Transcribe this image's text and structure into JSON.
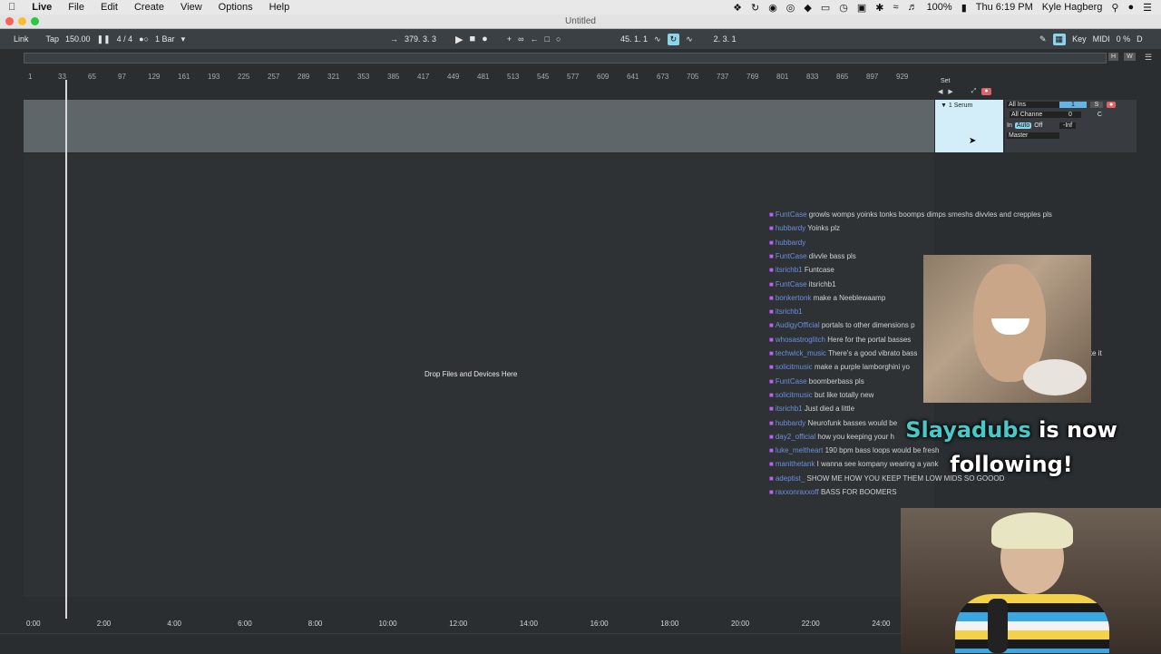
{
  "menubar": {
    "apple": "",
    "app": "Live",
    "items": [
      "File",
      "Edit",
      "Create",
      "View",
      "Options",
      "Help"
    ],
    "battery": "100%",
    "time": "Thu 6:19 PM",
    "user": "Kyle Hagberg"
  },
  "window": {
    "title": "Untitled"
  },
  "control": {
    "link": "Link",
    "tap": "Tap",
    "tempo": "150.00",
    "signature": "4 / 4",
    "quantize": "1 Bar",
    "position": "379.  3.  3",
    "loop_start": "45.  1.  1",
    "loop_length": "2.  3.  1",
    "key": "Key",
    "midi": "MIDI",
    "cpu": "0 %",
    "d": "D"
  },
  "ruler": [
    "1",
    "33",
    "65",
    "97",
    "129",
    "161",
    "193",
    "225",
    "257",
    "289",
    "321",
    "353",
    "385",
    "417",
    "449",
    "481",
    "513",
    "545",
    "577",
    "609",
    "641",
    "673",
    "705",
    "737",
    "769",
    "801",
    "833",
    "865",
    "897",
    "929"
  ],
  "timeruler": [
    "0:00",
    "2:00",
    "4:00",
    "6:00",
    "8:00",
    "10:00",
    "12:00",
    "14:00",
    "16:00",
    "18:00",
    "20:00",
    "22:00",
    "24:00"
  ],
  "drop_message": "Drop Files and Devices Here",
  "set": {
    "label": "Set",
    "track_name": "1 Serum",
    "input_type": "All Ins",
    "input_channel": "All Channe",
    "monitor_in": "In",
    "monitor_auto": "Auto",
    "monitor_off": "Off",
    "output": "Master",
    "track_number": "1",
    "solo": "S",
    "volume": "0",
    "pan": "C",
    "peak": "-Inf"
  },
  "chat": [
    {
      "user": "FuntCase",
      "msg": "growls womps yoinks tonks boomps dimps smeshs divvles and crepples pls"
    },
    {
      "user": "hubbardy",
      "msg": "Yoinks plz"
    },
    {
      "user": "hubbardy",
      "msg": ""
    },
    {
      "user": "FuntCase",
      "msg": "divvle bass pls"
    },
    {
      "user": "itsrichb1",
      "msg": "Funtcase"
    },
    {
      "user": "FuntCase",
      "msg": "itsrichb1"
    },
    {
      "user": "bonkertonk",
      "msg": "make a Neeblewaamp"
    },
    {
      "user": "itsrichb1",
      "msg": ""
    },
    {
      "user": "AudigyOfficial",
      "msg": "portals to other dimensions p"
    },
    {
      "user": "whosastroglitch",
      "msg": "Here for the portal basses"
    },
    {
      "user": "techwick_music",
      "msg": "There's a good vibrato bass"
    },
    {
      "user": "solicitmusic",
      "msg": "make a purple lamborghini yo"
    },
    {
      "user": "FuntCase",
      "msg": "boomberbass pls"
    },
    {
      "user": "solicitmusic",
      "msg": "but like totally new"
    },
    {
      "user": "itsrichb1",
      "msg": "Just died a little"
    },
    {
      "user": "hubbardy",
      "msg": "Neurofunk basses would be"
    },
    {
      "user": "day2_official",
      "msg": "how you keeping your h"
    },
    {
      "user": "luke_meltheart",
      "msg": "190 bpm bass loops would be fresh"
    },
    {
      "user": "manithetank",
      "msg": "I wanna see kompany wearing a yank"
    },
    {
      "user": "adeptist_",
      "msg": "SHOW ME HOW YOU KEEP THEM LOW MIDS SO GOOOD"
    },
    {
      "user": "raxxonraxxoff",
      "msg": "BASS FOR BOOMERS"
    }
  ],
  "chat_overflow": "ke it",
  "follow_alert": {
    "username": "Slayadubs",
    "text1": " is now",
    "text2": "following!"
  }
}
